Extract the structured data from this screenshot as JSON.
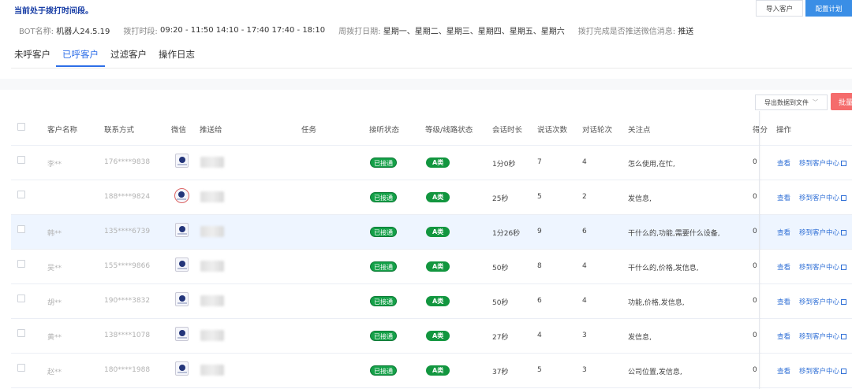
{
  "header": {
    "status": "当前处于拨打时间段。",
    "import_button": "导入客户",
    "config_button": "配置计划"
  },
  "info": {
    "bot_label": "BOT名称:",
    "bot_value": "机器人24.5.19",
    "time_label": "拨打时段:",
    "time_value": "09:20 - 11:50 14:10 - 17:40 17:40 - 18:10",
    "days_label": "周拨打日期:",
    "days_value": "星期一、星期二、星期三、星期四、星期五、星期六",
    "push_label": "拨打完成是否推送微信消息:",
    "push_value": "推送"
  },
  "tabs": [
    "未呼客户",
    "已呼客户",
    "过滤客户",
    "操作日志"
  ],
  "toolbar": {
    "export_label": "导出数据到文件",
    "batch_label": "批量"
  },
  "table": {
    "columns": {
      "name": "客户名称",
      "contact": "联系方式",
      "wechat": "微信",
      "push_to": "推送给",
      "task": "任务",
      "answer_status": "接听状态",
      "level": "等级/线路状态",
      "duration": "会话时长",
      "speak_count": "说话次数",
      "rounds": "对话轮次",
      "focus": "关注点",
      "score": "得分",
      "actions": "操作"
    },
    "view_label": "查看",
    "move_label": "移到客户中心",
    "rows": [
      {
        "name": "李**",
        "contact": "176****9838",
        "status": "已接通",
        "level": "A类",
        "duration": "1分0秒",
        "speak": "7",
        "rounds": "4",
        "focus": "怎么使用,在忙,",
        "score": "0"
      },
      {
        "name": "",
        "contact": "188****9824",
        "status": "已接通",
        "level": "A类",
        "duration": "25秒",
        "speak": "5",
        "rounds": "2",
        "focus": "发信息,",
        "score": "0"
      },
      {
        "name": "韩**",
        "contact": "135****6739",
        "status": "已接通",
        "level": "A类",
        "duration": "1分26秒",
        "speak": "9",
        "rounds": "6",
        "focus": "干什么的,功能,需要什么设备,",
        "score": "0"
      },
      {
        "name": "吴**",
        "contact": "155****9866",
        "status": "已接通",
        "level": "A类",
        "duration": "50秒",
        "speak": "8",
        "rounds": "4",
        "focus": "干什么的,价格,发信息,",
        "score": "0"
      },
      {
        "name": "胡**",
        "contact": "190****3832",
        "status": "已接通",
        "level": "A类",
        "duration": "50秒",
        "speak": "6",
        "rounds": "4",
        "focus": "功能,价格,发信息,",
        "score": "0"
      },
      {
        "name": "黄**",
        "contact": "138****1078",
        "status": "已接通",
        "level": "A类",
        "duration": "27秒",
        "speak": "4",
        "rounds": "3",
        "focus": "发信息,",
        "score": "0"
      },
      {
        "name": "赵**",
        "contact": "180****1988",
        "status": "已接通",
        "level": "A类",
        "duration": "37秒",
        "speak": "5",
        "rounds": "3",
        "focus": "公司位置,发信息,",
        "score": "0"
      }
    ]
  }
}
